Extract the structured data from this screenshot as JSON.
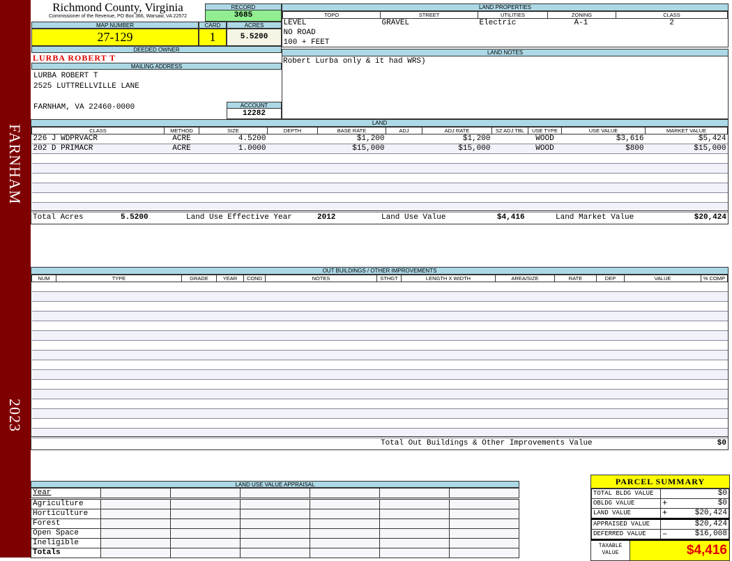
{
  "sidebar": {
    "town": "FARNHAM",
    "year": "2023",
    "color": "#7f0000"
  },
  "header": {
    "title": "Richmond County, Virginia",
    "subtitle": "Commissioner of the Revenue, PO Box 366, Warsaw, VA 22572",
    "record_label": "RECORD",
    "record": "3685"
  },
  "parcel": {
    "map_label": "MAP NUMBER",
    "map_number": "27-129",
    "card_label": "CARD",
    "card": "1",
    "acres_label": "ACRES",
    "acres": "5.5200"
  },
  "owner": {
    "deeded_label": "DEEDED OWNER",
    "deeded": "LURBA ROBERT T",
    "mailing_label": "MAILING ADDRESS",
    "lines": [
      "LURBA ROBERT T",
      "2525 LUTTRELLVILLE LANE",
      "",
      "FARNHAM, VA 22460-0000"
    ],
    "account_label": "ACCOUNT",
    "account": "12282"
  },
  "land_properties": {
    "title": "LAND PROPERTIES",
    "headers": [
      "TOPO",
      "STREET",
      "UTILITIES",
      "ZONING",
      "CLASS"
    ],
    "topo": [
      "LEVEL",
      "NO ROAD",
      "100 + FEET"
    ],
    "street": "GRAVEL",
    "utilities": "Electric",
    "zoning": "A-1",
    "class": "2"
  },
  "land_notes": {
    "title": "LAND NOTES",
    "text": "Robert Lurba only & it had WRS)"
  },
  "land": {
    "title": "LAND",
    "headers": [
      "CLASS",
      "METHOD",
      "SIZE",
      "DEPTH",
      "BASE RATE",
      "ADJ",
      "ADJ RATE",
      "SZ ADJ TBL",
      "USE TYPE",
      "USE VALUE",
      "MARKET VALUE"
    ],
    "rows": [
      [
        "226 J WDPRVACR",
        "ACRE",
        "4.5200",
        "",
        "$1,200",
        "",
        "$1,200",
        "",
        "WOOD",
        "$3,616",
        "$5,424"
      ],
      [
        "202 D PRIMACR",
        "ACRE",
        "1.0000",
        "",
        "$15,000",
        "",
        "$15,000",
        "",
        "WOOD",
        "$800",
        "$15,000"
      ]
    ],
    "totals": {
      "acres_label": "Total Acres",
      "acres": "5.5200",
      "year_label": "Land Use Effective Year",
      "year": "2012",
      "use_label": "Land Use Value",
      "use_value": "$4,416",
      "market_label": "Land Market Value",
      "market_value": "$20,424"
    }
  },
  "outbuildings": {
    "title": "OUT BUILDINGS / OTHER IMPROVEMENTS",
    "headers": [
      "NUM",
      "TYPE",
      "GRADE",
      "YEAR",
      "COND",
      "NOTES",
      "STHGT",
      "LENGTH X WIDTH",
      "AREA/SIZE",
      "RATE",
      "DEP",
      "VALUE",
      "% COMP"
    ],
    "total_label": "Total Out Buildings & Other Improvements Value",
    "total": "$0"
  },
  "land_use_appraisal": {
    "title": "LAND USE VALUE APPRAISAL",
    "year_label": "Year",
    "rows": [
      "Agriculture",
      "Horticulture",
      "Forest",
      "Open Space",
      "Ineligible"
    ],
    "totals_label": "Totals"
  },
  "summary": {
    "title": "PARCEL SUMMARY",
    "rows": [
      {
        "label": "TOTAL BLDG VALUE",
        "op": "",
        "value": "$0"
      },
      {
        "label": "OBLDG VALUE",
        "op": "+",
        "value": "$0"
      },
      {
        "label": "LAND VALUE",
        "op": "+",
        "value": "$20,424"
      },
      {
        "label": "APPRAISED VALUE",
        "op": "",
        "value": "$20,424"
      },
      {
        "label": "DEFERRED VALUE",
        "op": "–",
        "value": "$16,008"
      }
    ],
    "taxable_label": "TAXABLE VALUE",
    "taxable": "$4,416"
  }
}
